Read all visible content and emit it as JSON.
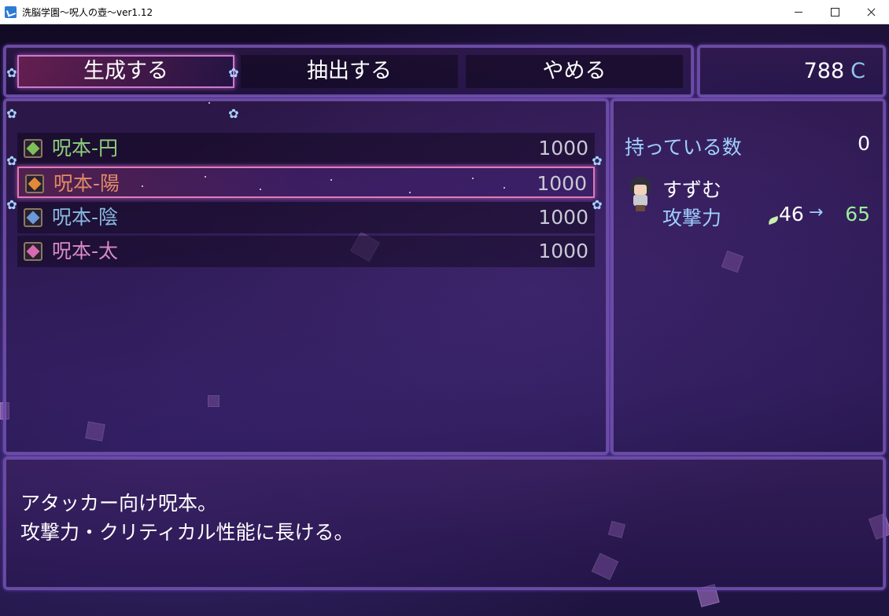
{
  "window": {
    "title": "洗脳学園～呪人の壺～ver1.12",
    "controls": [
      "minimize",
      "maximize",
      "close"
    ]
  },
  "commands": [
    {
      "label": "生成する",
      "selected": true
    },
    {
      "label": "抽出する",
      "selected": false
    },
    {
      "label": "やめる",
      "selected": false
    }
  ],
  "gold": {
    "amount": "788",
    "unit": "C"
  },
  "items": [
    {
      "name": "呪本-円",
      "price": "1000",
      "color": "#8fcf7a",
      "icon_color": "#7fbf5a",
      "selected": false
    },
    {
      "name": "呪本-陽",
      "price": "1000",
      "color": "#e08a66",
      "icon_color": "#e08a3a",
      "selected": true
    },
    {
      "name": "呪本-陰",
      "price": "1000",
      "color": "#8ab8e0",
      "icon_color": "#6a9ad8",
      "selected": false
    },
    {
      "name": "呪本-太",
      "price": "1000",
      "color": "#d88ac8",
      "icon_color": "#d86ab0",
      "selected": false
    }
  ],
  "status": {
    "possession_label": "持っている数",
    "possession_count": "0",
    "actor_name": "すずむ",
    "param_name": "攻撃力",
    "param_old": "46",
    "arrow": "→",
    "param_new": "65"
  },
  "help": {
    "line1": "アタッカー向け呪本。",
    "line2": "攻撃力・クリティカル性能に長ける。"
  },
  "colors": {
    "system_text": "#9fd0ff",
    "power_up": "#98f098",
    "window_border": "#6b4aa8",
    "cursor_border": "#e07ab8"
  }
}
